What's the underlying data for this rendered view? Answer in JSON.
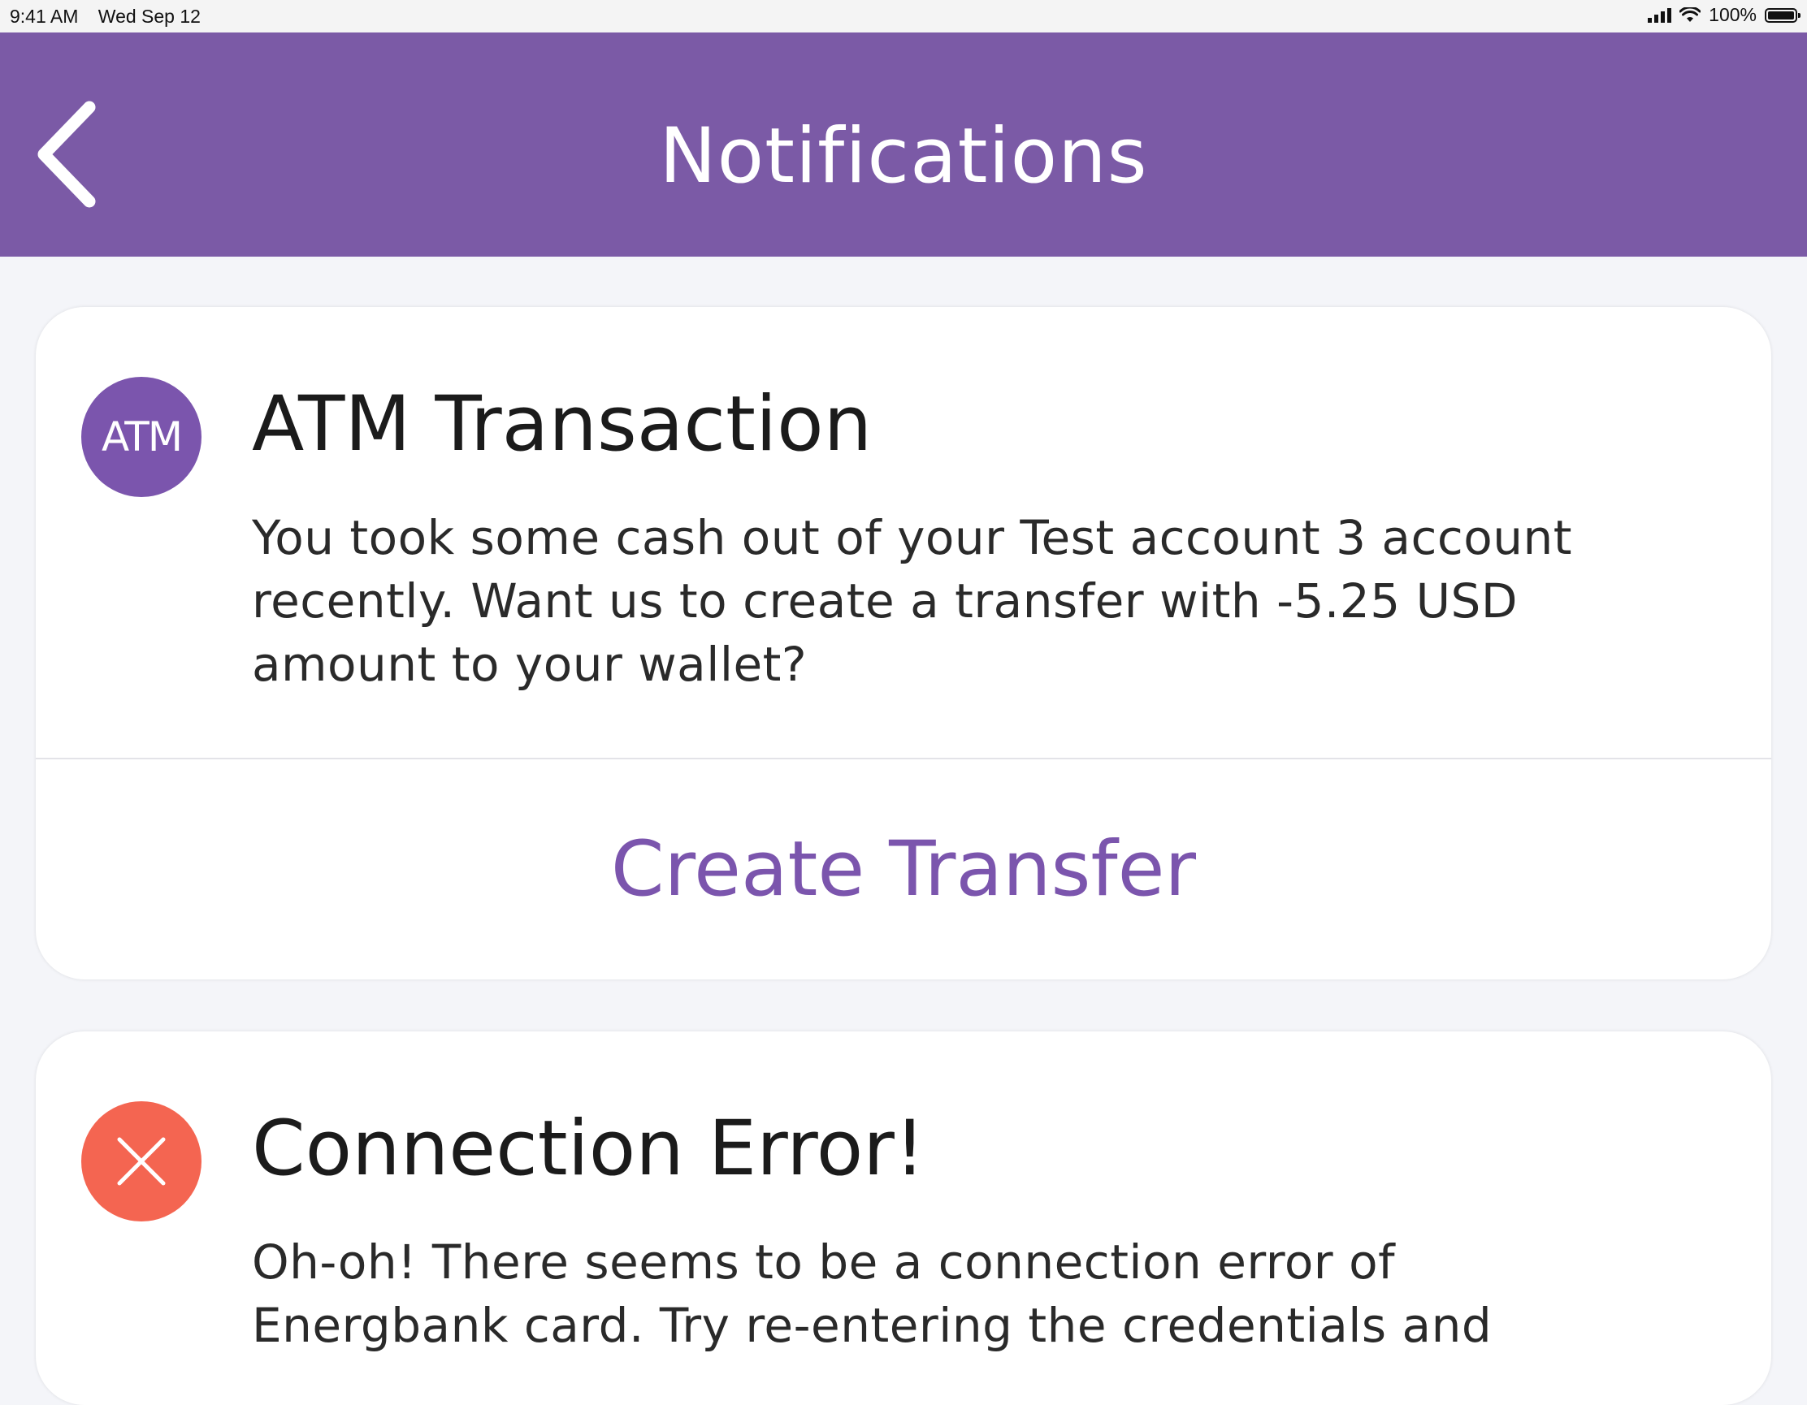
{
  "status_bar": {
    "time": "9:41 AM",
    "date": "Wed Sep 12",
    "battery_percent": "100%"
  },
  "nav": {
    "title": "Notifications",
    "back_icon": "chevron-left-icon"
  },
  "notifications": [
    {
      "icon": "atm-icon",
      "icon_label": "ATM",
      "icon_color": "#7b55ad",
      "title": "ATM Transaction",
      "body_lines": [
        "You took some cash out of your Test account 3 account",
        "recently. Want us to create a transfer with -5.25 USD",
        "amount to your wallet?"
      ],
      "action_label": "Create Transfer"
    },
    {
      "icon": "close-icon",
      "icon_color": "#f46551",
      "title": "Connection Error!",
      "body_lines": [
        "Oh-oh! There seems to be a connection error of",
        "Energbank card. Try re-entering the credentials and"
      ]
    }
  ],
  "colors": {
    "header": "#7b5aa6",
    "accent": "#7b55ad",
    "error": "#f46551",
    "background": "#f4f5f9"
  }
}
